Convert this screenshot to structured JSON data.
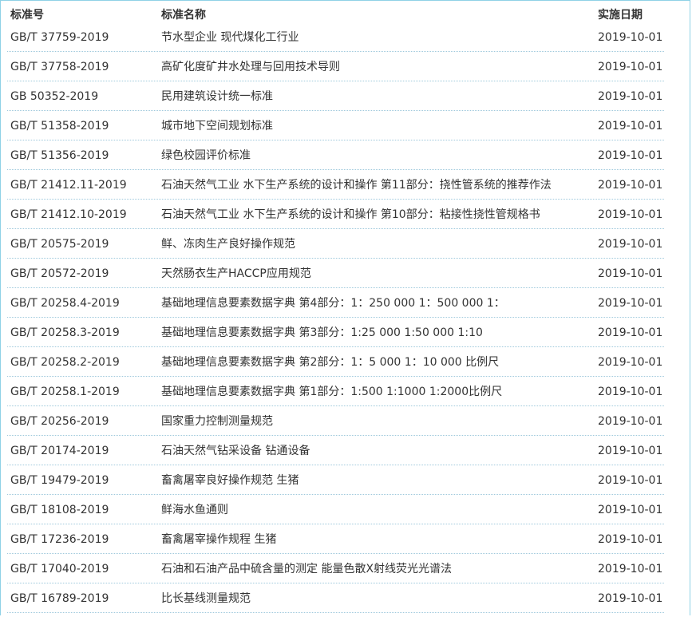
{
  "table": {
    "headers": {
      "code": "标准号",
      "name": "标准名称",
      "date": "实施日期"
    },
    "rows": [
      {
        "code": "GB/T 37759-2019",
        "name": "节水型企业 现代煤化工行业",
        "date": "2019-10-01"
      },
      {
        "code": "GB/T 37758-2019",
        "name": "高矿化度矿井水处理与回用技术导则",
        "date": "2019-10-01"
      },
      {
        "code": "GB 50352-2019",
        "name": "民用建筑设计统一标准",
        "date": "2019-10-01"
      },
      {
        "code": "GB/T 51358-2019",
        "name": "城市地下空间规划标准",
        "date": "2019-10-01"
      },
      {
        "code": "GB/T 51356-2019",
        "name": "绿色校园评价标准",
        "date": "2019-10-01"
      },
      {
        "code": "GB/T 21412.11-2019",
        "name": "石油天然气工业 水下生产系统的设计和操作 第11部分：挠性管系统的推荐作法",
        "date": "2019-10-01"
      },
      {
        "code": "GB/T 21412.10-2019",
        "name": "石油天然气工业 水下生产系统的设计和操作 第10部分：粘接性挠性管规格书",
        "date": "2019-10-01"
      },
      {
        "code": "GB/T 20575-2019",
        "name": "鲜、冻肉生产良好操作规范",
        "date": "2019-10-01"
      },
      {
        "code": "GB/T 20572-2019",
        "name": "天然肠衣生产HACCP应用规范",
        "date": "2019-10-01"
      },
      {
        "code": "GB/T 20258.4-2019",
        "name": "基础地理信息要素数据字典 第4部分：1：250 000 1：500 000 1：",
        "date": "2019-10-01"
      },
      {
        "code": "GB/T 20258.3-2019",
        "name": "基础地理信息要素数据字典 第3部分：1:25 000 1:50 000 1:10",
        "date": "2019-10-01"
      },
      {
        "code": "GB/T 20258.2-2019",
        "name": "基础地理信息要素数据字典 第2部分：1：5 000 1：10 000 比例尺",
        "date": "2019-10-01"
      },
      {
        "code": "GB/T 20258.1-2019",
        "name": "基础地理信息要素数据字典 第1部分：1:500 1:1000 1:2000比例尺",
        "date": "2019-10-01"
      },
      {
        "code": "GB/T 20256-2019",
        "name": "国家重力控制测量规范",
        "date": "2019-10-01"
      },
      {
        "code": "GB/T 20174-2019",
        "name": "石油天然气钻采设备 钻通设备",
        "date": "2019-10-01"
      },
      {
        "code": "GB/T 19479-2019",
        "name": "畜禽屠宰良好操作规范 生猪",
        "date": "2019-10-01"
      },
      {
        "code": "GB/T 18108-2019",
        "name": "鲜海水鱼通则",
        "date": "2019-10-01"
      },
      {
        "code": "GB/T 17236-2019",
        "name": "畜禽屠宰操作规程 生猪",
        "date": "2019-10-01"
      },
      {
        "code": "GB/T 17040-2019",
        "name": "石油和石油产品中硫含量的测定 能量色散X射线荧光光谱法",
        "date": "2019-10-01"
      },
      {
        "code": "GB/T 16789-2019",
        "name": "比长基线测量规范",
        "date": "2019-10-01"
      }
    ]
  },
  "colors": {
    "frame_border": "#8fd1e6",
    "row_separator": "#9fc9dc",
    "text": "#333333"
  }
}
